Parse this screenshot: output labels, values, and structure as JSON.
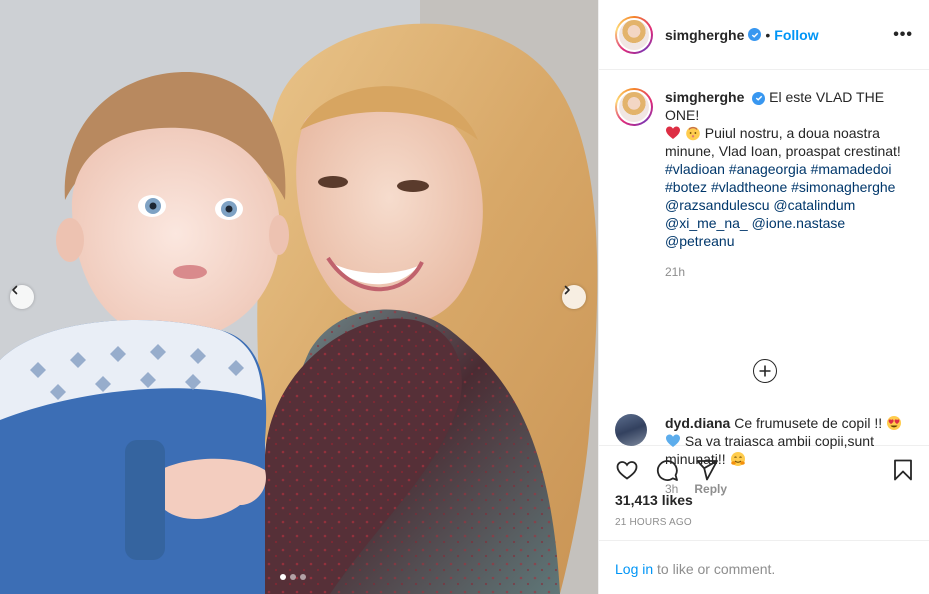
{
  "post": {
    "account": "simgherghe",
    "follow_label": "Follow",
    "separator": "•",
    "more_icon": "•••",
    "caption": {
      "username": "simgherghe",
      "line1": "El este VLAD THE ONE!",
      "line2": "Puiul nostru, a doua noastra minune, Vlad Ioan, proaspat crestinat!",
      "hashtags": [
        "#vladioan",
        "#anageorgia",
        "#mamadedoi",
        "#botez",
        "#vladtheone",
        "#simonagherghe"
      ],
      "mentions": [
        "@razsandulescu",
        "@catalindum",
        "@xi_me_na_",
        "@ione.nastase",
        "@petreanu"
      ],
      "time": "21h"
    },
    "comment": {
      "username": "dyd.diana",
      "text1": "Ce frumusete de copil !!",
      "text2": "Sa va traiasca ambii copii,sunt minunati!!",
      "time": "3h",
      "reply_label": "Reply"
    },
    "likes": "31,413 likes",
    "date": "21 HOURS AGO",
    "login_link": "Log in",
    "login_rest": " to like or comment.",
    "carousel": {
      "slides": 3,
      "current": 1
    }
  },
  "icons": [
    "verified-badge-icon",
    "heart-icon",
    "comment-icon",
    "share-icon",
    "bookmark-icon",
    "plus-circle-icon",
    "chevron-left-icon",
    "chevron-right-icon"
  ],
  "colors": {
    "link_blue": "#0095f6",
    "tag_blue": "#00376b",
    "muted": "#8e8e8e",
    "text": "#262626",
    "verified": "#3897f0"
  }
}
